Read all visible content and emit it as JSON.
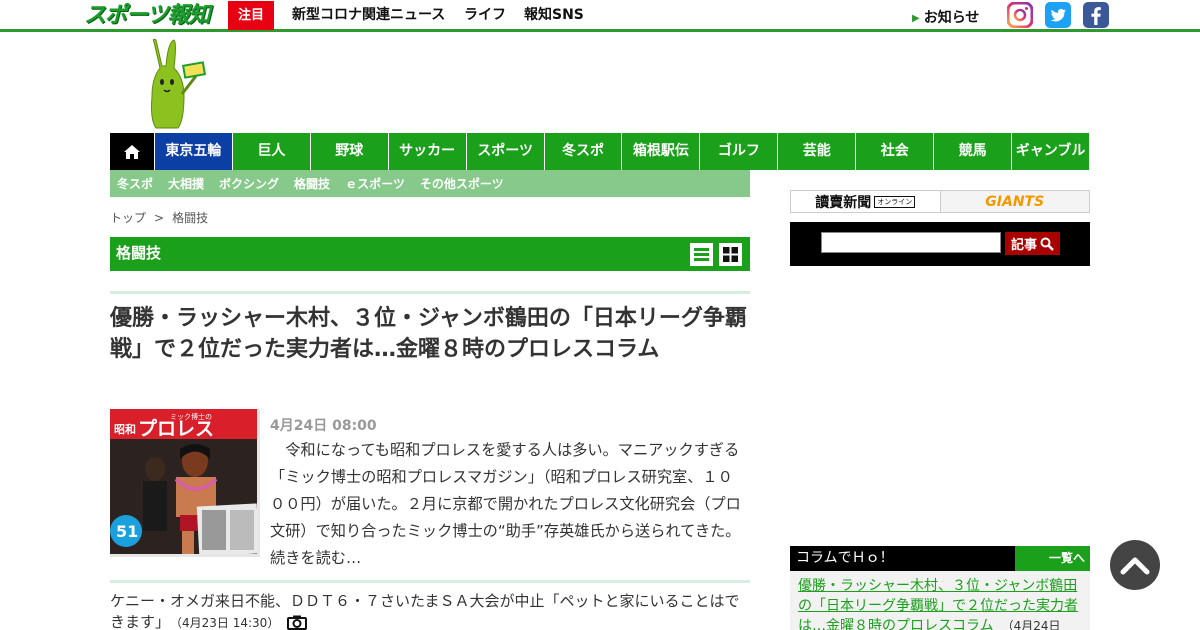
{
  "header": {
    "logo_text": "スポーツ報知",
    "attention_label": "注目",
    "links": [
      "新型コロナ関連ニュース",
      "ライフ",
      "報知SNS"
    ],
    "notice_label": "お知らせ",
    "social": [
      {
        "name": "instagram",
        "color": "#c13584"
      },
      {
        "name": "twitter",
        "color": "#1da1f2"
      },
      {
        "name": "facebook",
        "color": "#3b5998"
      }
    ]
  },
  "nav": {
    "home_icon": "home-icon",
    "items": [
      "東京五輪",
      "巨人",
      "野球",
      "サッカー",
      "スポーツ",
      "冬スポ",
      "箱根駅伝",
      "ゴルフ",
      "芸能",
      "社会",
      "競馬",
      "ギャンブル"
    ],
    "active": "東京五輪",
    "sub_items": [
      "冬スポ",
      "大相撲",
      "ボクシング",
      "格闘技",
      "ｅスポーツ",
      "その他スポーツ"
    ]
  },
  "breadcrumb": {
    "home": "トップ",
    "separator": ">",
    "current": "格闘技"
  },
  "section": {
    "title": "格闘技",
    "list_view_icon": "list-view-icon",
    "grid_view_icon": "grid-view-icon"
  },
  "article": {
    "headline": "優勝・ラッシャー木村、３位・ジャンボ鶴田の「日本リーグ争覇戦」で２位だった実力者は…金曜８時のプロレスコラム",
    "date": "4月24日 08:00",
    "lead": "　令和になっても昭和プロレスを愛する人は多い。マニアックすぎる「ミック博士の昭和プロレスマガジン」（昭和プロレス研究室、１０００円）が届いた。２月に京都で開かれたプロレス文化研究会（プロ文研）で知り合ったミック博士の“助手”存英雄氏から送られてきた。",
    "read_more": "続きを読む…",
    "thumb": {
      "title": "プロレス",
      "super": "ミック博士の",
      "left_label": "昭和",
      "number": "51"
    }
  },
  "sub_article": {
    "text": "ケニー・オメガ来日不能、ＤＤＴ６・７さいたまＳＡ大会が中止「ペットと家にいることはできます」",
    "date": "（4月23日 14:30）",
    "icon": "camera-icon"
  },
  "sidebar": {
    "banner_left": "讀賣新聞",
    "banner_left_tag": "オンライン",
    "banner_right": "GIANTS",
    "search_button": "記事",
    "column_title": "コラムでＨｏ！",
    "column_all": "一覧へ",
    "column_link": "優勝・ラッシャー木村、３位・ジャンボ鶴田の「日本リーグ争覇戦」で２位だった実力者は…金曜８時のプロレスコラム",
    "column_date": "（4月24日"
  }
}
